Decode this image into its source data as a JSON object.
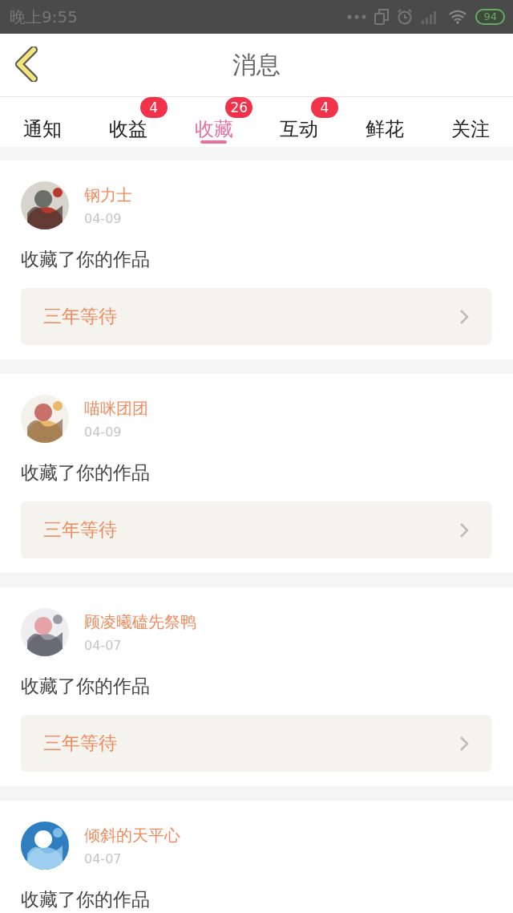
{
  "status_bar": {
    "time": "晚上9:55",
    "battery": "94"
  },
  "header": {
    "title": "消息"
  },
  "tabs": [
    {
      "label": "通知",
      "selected": false
    },
    {
      "label": "收益",
      "selected": false,
      "badge": "4"
    },
    {
      "label": "收藏",
      "selected": true,
      "badge": "26"
    },
    {
      "label": "互动",
      "selected": false,
      "badge": "4"
    },
    {
      "label": "鲜花",
      "selected": false
    },
    {
      "label": "关注",
      "selected": false
    }
  ],
  "messages": [
    {
      "name": "钢力士",
      "date": "04-09",
      "text": "收藏了你的作品",
      "work": "三年等待"
    },
    {
      "name": "喵咪团团",
      "date": "04-09",
      "text": "收藏了你的作品",
      "work": "三年等待"
    },
    {
      "name": "顾凌曦磕先祭鸭",
      "date": "04-07",
      "text": "收藏了你的作品",
      "work": "三年等待"
    },
    {
      "name": "倾斜的天平心",
      "date": "04-07",
      "text": "收藏了你的作品"
    }
  ]
}
